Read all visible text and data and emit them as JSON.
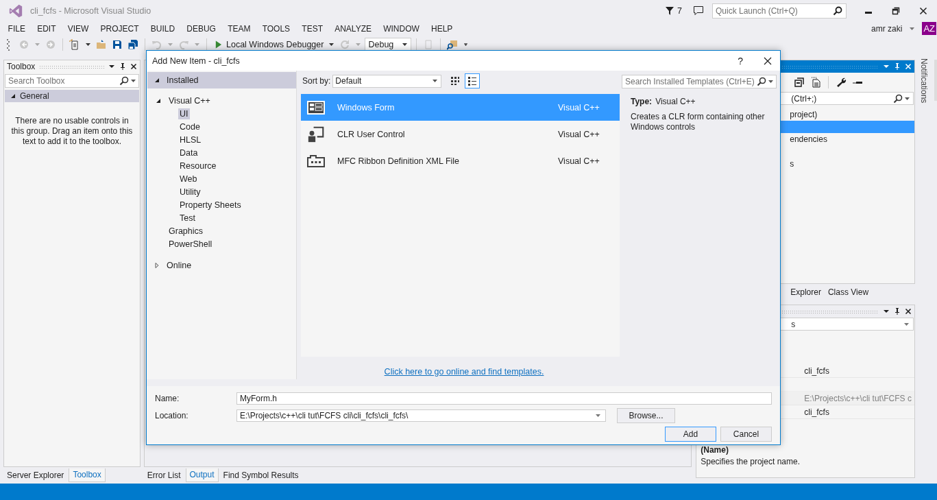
{
  "window": {
    "title": "cli_fcfs - Microsoft Visual Studio",
    "notification_count": "7",
    "quick_launch": {
      "placeholder": "Quick Launch (Ctrl+Q)"
    },
    "user": "amr zaki",
    "avatar": "AZ"
  },
  "menu": [
    "FILE",
    "EDIT",
    "VIEW",
    "PROJECT",
    "BUILD",
    "DEBUG",
    "TEAM",
    "TOOLS",
    "TEST",
    "ANALYZE",
    "WINDOW",
    "HELP"
  ],
  "toolbar": {
    "debugger": "Local Windows Debugger",
    "configuration": "Debug"
  },
  "toolbox": {
    "title": "Toolbox",
    "search": {
      "placeholder": "Search Toolbox"
    },
    "group": "General",
    "group_expanded": true,
    "empty_message": "There are no usable controls in this group. Drag an item onto this text to add it to the toolbox."
  },
  "left_tabs": [
    {
      "label": "Server Explorer",
      "selected": false
    },
    {
      "label": "Toolbox",
      "selected": true
    }
  ],
  "bottom_tabs": [
    {
      "label": "Error List",
      "selected": false
    },
    {
      "label": "Output",
      "selected": true
    },
    {
      "label": "Find Symbol Results",
      "selected": false
    }
  ],
  "solution_explorer": {
    "search_value": "(Ctrl+;)",
    "rows": [
      {
        "text": "project)",
        "selected": false
      },
      {
        "selected": true
      },
      {
        "text": "endencies",
        "selected": false
      },
      {
        "selected": false
      },
      {
        "text": "s",
        "selected": false
      }
    ],
    "tabs": [
      "Explorer",
      "Class View"
    ]
  },
  "properties": {
    "dropdown": "s",
    "rows": [
      {
        "value": "cli_fcfs",
        "greyed": false
      },
      {
        "kind": "empty"
      },
      {
        "value": "E:\\Projects\\c++\\cli tut\\FCFS c",
        "greyed": true
      },
      {
        "value": "cli_fcfs",
        "greyed": false
      }
    ],
    "description_title": "(Name)",
    "description": "Specifies the project name."
  },
  "notifications_tab": "Notifications",
  "dialog": {
    "title": "Add New Item - cli_fcfs",
    "help": "?",
    "sections": [
      {
        "label": "Installed",
        "expanded": true,
        "children": [
          {
            "label": "Visual C++",
            "expanded": true,
            "selected": false,
            "children": [
              {
                "label": "UI",
                "selected": true
              },
              {
                "label": "Code",
                "selected": false
              },
              {
                "label": "HLSL",
                "selected": false
              },
              {
                "label": "Data",
                "selected": false
              },
              {
                "label": "Resource",
                "selected": false
              },
              {
                "label": "Web",
                "selected": false
              },
              {
                "label": "Utility",
                "selected": false
              },
              {
                "label": "Property Sheets",
                "selected": false
              },
              {
                "label": "Test",
                "selected": false
              }
            ]
          },
          {
            "label": "Graphics",
            "selected": false
          },
          {
            "label": "PowerShell",
            "selected": false
          }
        ]
      },
      {
        "label": "Online",
        "expanded": false
      }
    ],
    "sort_label": "Sort by:",
    "sort_value": "Default",
    "views": [
      {
        "kind": "grid",
        "selected": false
      },
      {
        "kind": "list",
        "selected": true
      }
    ],
    "search": {
      "placeholder": "Search Installed Templates (Ctrl+E)"
    },
    "templates": [
      {
        "kind": "form",
        "name": "Windows Form",
        "language": "Visual C++",
        "selected": true
      },
      {
        "kind": "user-control",
        "name": "CLR User Control",
        "language": "Visual C++",
        "selected": false
      },
      {
        "kind": "ribbon",
        "name": "MFC Ribbon Definition XML File",
        "language": "Visual C++",
        "selected": false
      }
    ],
    "details": {
      "type_label": "Type:",
      "type_value": "Visual C++",
      "description": "Creates a CLR form containing other Windows controls"
    },
    "online_link": "Click here to go online and find templates.",
    "name_label": "Name:",
    "name_value": "MyForm.h",
    "location_label": "Location:",
    "location_value": "E:\\Projects\\c++\\cli tut\\FCFS cli\\cli_fcfs\\cli_fcfs\\",
    "browse": "Browse...",
    "add": "Add",
    "cancel": "Cancel"
  }
}
